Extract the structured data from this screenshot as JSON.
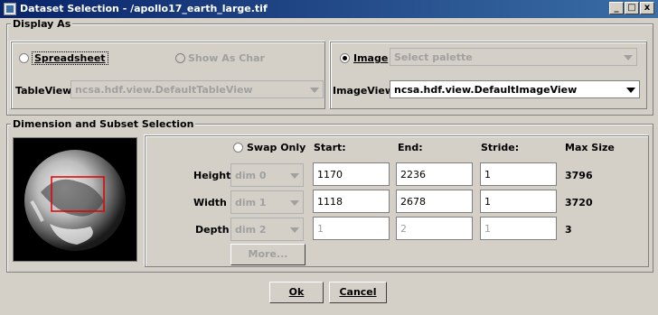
{
  "window": {
    "title": "Dataset Selection - /apollo17_earth_large.tif",
    "controls": [
      "_",
      "□",
      "x"
    ]
  },
  "display_as": {
    "legend": "Display As",
    "spreadsheet_label": "Spreadsheet",
    "show_as_char_label": "Show As Char",
    "tableview_label": "TableView:",
    "tableview_value": "ncsa.hdf.view.DefaultTableView",
    "image_label": "Image",
    "palette_value": "Select palette",
    "imageview_label": "ImageView:",
    "imageview_value": "ncsa.hdf.view.DefaultImageView",
    "selected": "Image"
  },
  "subset": {
    "legend": "Dimension and Subset Selection",
    "swap_only_label": "Swap Only",
    "headers": {
      "start": "Start:",
      "end": "End:",
      "stride": "Stride:",
      "max_size": "Max Size"
    },
    "rows": [
      {
        "label": "Height",
        "dim": "dim 0",
        "start": "1170",
        "end": "2236",
        "stride": "1",
        "max": "3796",
        "enabled": true
      },
      {
        "label": "Width",
        "dim": "dim 1",
        "start": "1118",
        "end": "2678",
        "stride": "1",
        "max": "3720",
        "enabled": true
      },
      {
        "label": "Depth",
        "dim": "dim 2",
        "start": "1",
        "end": "2",
        "stride": "1",
        "max": "3",
        "enabled": false
      }
    ],
    "more_label": "More..."
  },
  "buttons": {
    "ok": "Ok",
    "cancel": "Cancel"
  }
}
